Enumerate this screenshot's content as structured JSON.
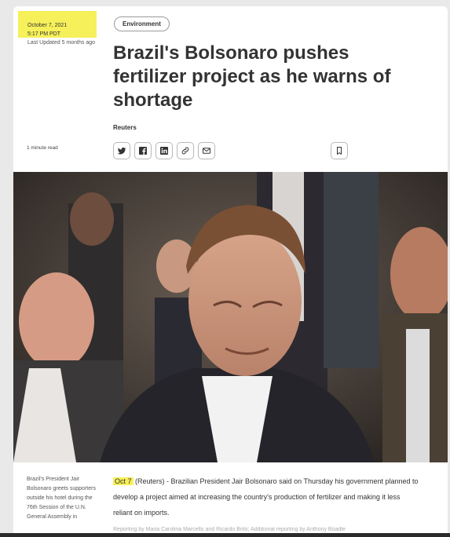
{
  "meta": {
    "date": "October 7, 2021",
    "time": "5:17 PM PDT",
    "updated": "Last Updated 5 months ago",
    "read_time": "1 minute read"
  },
  "article": {
    "category": "Environment",
    "headline": "Brazil's Bolsonaro pushes fertilizer project as he warns of shortage",
    "byline": "Reuters"
  },
  "share_icons": [
    "twitter-icon",
    "facebook-icon",
    "linkedin-icon",
    "link-icon",
    "email-icon"
  ],
  "bookmark_icon": "bookmark-icon",
  "photo": {
    "caption": "Brazil's President Jair Bolsonaro greets supporters outside his hotel during the 76th Session of the U.N. General Assembly in"
  },
  "body": {
    "dateline_highlight": "Oct 7",
    "lead_text": " (Reuters) - Brazilian President Jair Bolsonaro said on Thursday his government planned to develop a project aimed at increasing the country's production of fertilizer and making it less reliant on imports.",
    "credit": "Reporting by Maria Carolina Marcello and Ricardo Brito; Additional reporting by Anthony Boadle"
  },
  "colors": {
    "highlight": "#f6f05a",
    "background": "#e9e9e9",
    "text": "#333333"
  }
}
